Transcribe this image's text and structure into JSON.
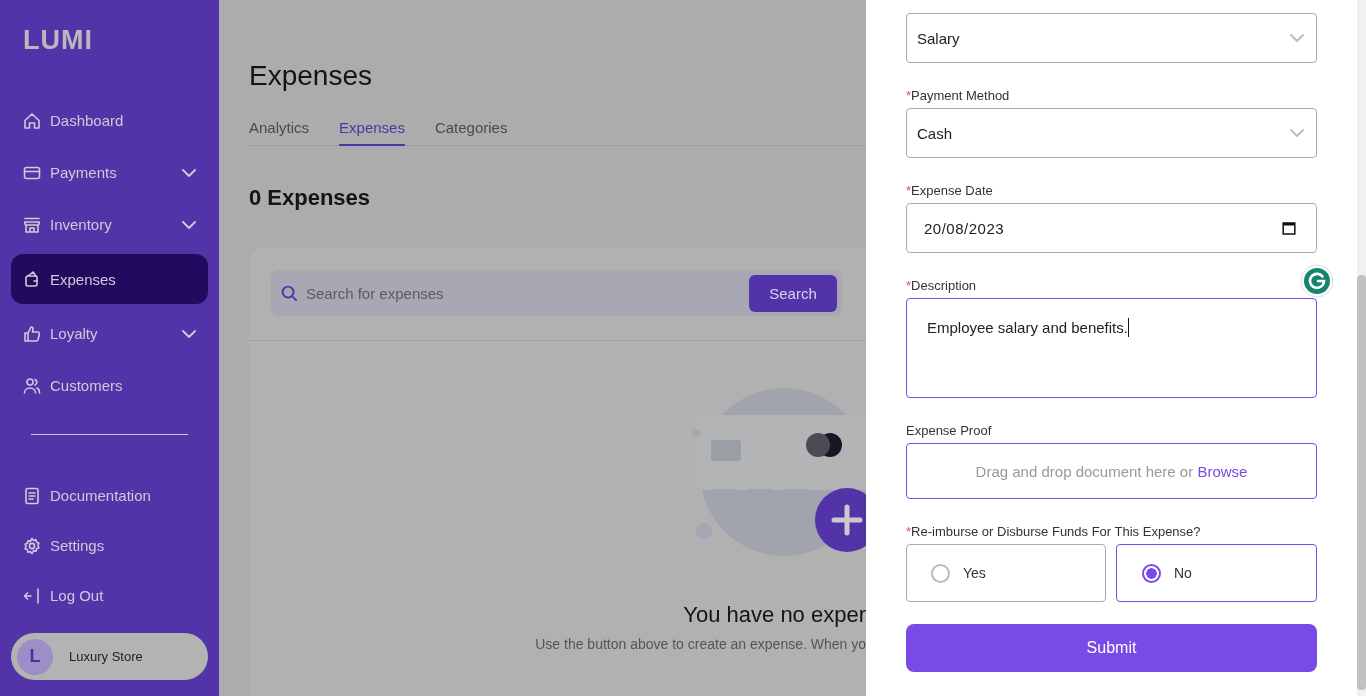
{
  "sidebar": {
    "logo": "LUMI",
    "items": [
      {
        "label": "Dashboard",
        "expandable": false,
        "selected": false
      },
      {
        "label": "Payments",
        "expandable": true,
        "selected": false
      },
      {
        "label": "Inventory",
        "expandable": true,
        "selected": false
      },
      {
        "label": "Expenses",
        "expandable": false,
        "selected": true
      },
      {
        "label": "Loyalty",
        "expandable": true,
        "selected": false
      },
      {
        "label": "Customers",
        "expandable": false,
        "selected": false
      }
    ],
    "footer_items": [
      {
        "label": "Documentation"
      },
      {
        "label": "Settings"
      },
      {
        "label": "Log Out"
      }
    ],
    "account": {
      "initial": "L",
      "name": "Luxury Store"
    }
  },
  "page": {
    "title": "Expenses",
    "tabs": [
      {
        "label": "Analytics",
        "selected": false
      },
      {
        "label": "Expenses",
        "selected": true
      },
      {
        "label": "Categories",
        "selected": false
      }
    ],
    "count_heading": "0 Expenses",
    "search": {
      "placeholder": "Search for expenses",
      "button": "Search"
    },
    "empty_state": {
      "title": "You have no exper",
      "message": "Use the button above to create an expense. When yo"
    }
  },
  "drawer": {
    "fields": [
      {
        "kind": "select",
        "value": "Salary"
      },
      {
        "kind": "select",
        "marker": "*",
        "label": "Payment Method",
        "value": "Cash"
      },
      {
        "kind": "date",
        "marker": "*",
        "label": "Expense Date",
        "value": "20/08/2023"
      },
      {
        "kind": "textarea",
        "marker": "*",
        "label": "Description",
        "value": "Employee salary and benefits.",
        "focused": true
      },
      {
        "kind": "upload",
        "label": "Expense Proof",
        "text": "Drag and drop document here or",
        "link": "Browse"
      },
      {
        "kind": "radio",
        "marker": "*",
        "label": "Re-imburse or Disburse Funds For This Expense?",
        "options": [
          {
            "label": "Yes",
            "selected": false
          },
          {
            "label": "No",
            "selected": true
          }
        ]
      }
    ],
    "submit": "Submit"
  }
}
